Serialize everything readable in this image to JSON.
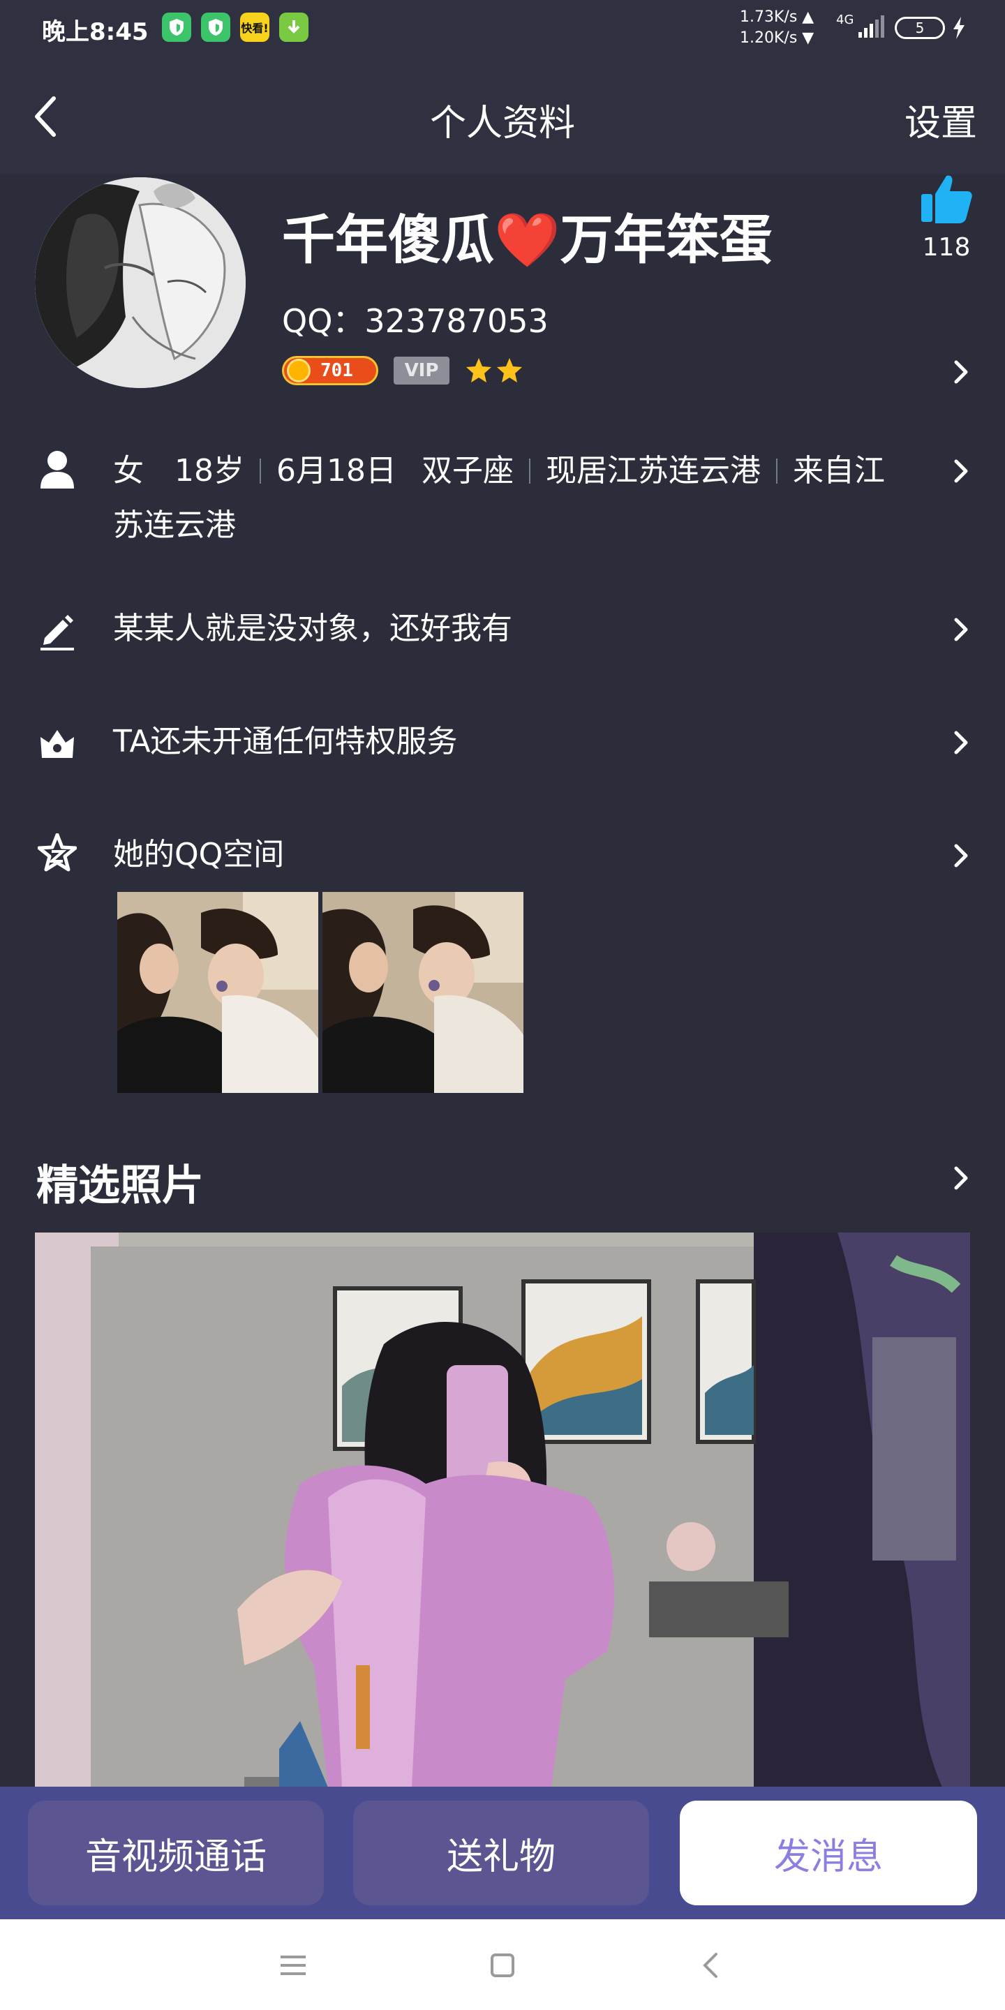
{
  "status_bar": {
    "time": "晚上8:45",
    "apps": [
      {
        "icon": "shield-app-icon",
        "color": "#3cc46b",
        "label": ""
      },
      {
        "icon": "shield-app-icon",
        "color": "#3cc46b",
        "label": ""
      },
      {
        "icon": "kuaikan-app-icon",
        "color": "#f7d21c",
        "label": "快看!"
      },
      {
        "icon": "download-app-icon",
        "color": "#7ac943",
        "label": ""
      }
    ],
    "net_up": "1.73K/s ▲",
    "net_down": "1.20K/s ▼",
    "network_type": "4G",
    "battery": "5"
  },
  "header": {
    "title": "个人资料",
    "settings_label": "设置"
  },
  "profile": {
    "nickname": "千年傻瓜❤️万年笨蛋",
    "qq": "QQ：323787053",
    "level": "701",
    "vip_label": "VIP",
    "star_count": 2,
    "likes": "118"
  },
  "info_rows": {
    "basic": {
      "gender": "女",
      "age": "18岁",
      "birthday": "6月18日",
      "zodiac": "双子座",
      "residence": "现居江苏连云港",
      "hometown_line1": "来自江",
      "hometown_line2": "苏连云港"
    },
    "signature": "某某人就是没对象，还好我有",
    "privilege": "TA还未开通任何特权服务",
    "qzone": "她的QQ空间"
  },
  "photos": {
    "section_title": "精选照片"
  },
  "actions": {
    "call_label": "音视频通话",
    "gift_label": "送礼物",
    "message_label": "发消息"
  },
  "colors": {
    "background": "#2b2d3b",
    "header": "#2f3140",
    "accent_blue": "#1fb2f5",
    "action_bar": "#484b90",
    "message_text": "#8a7fe0"
  }
}
